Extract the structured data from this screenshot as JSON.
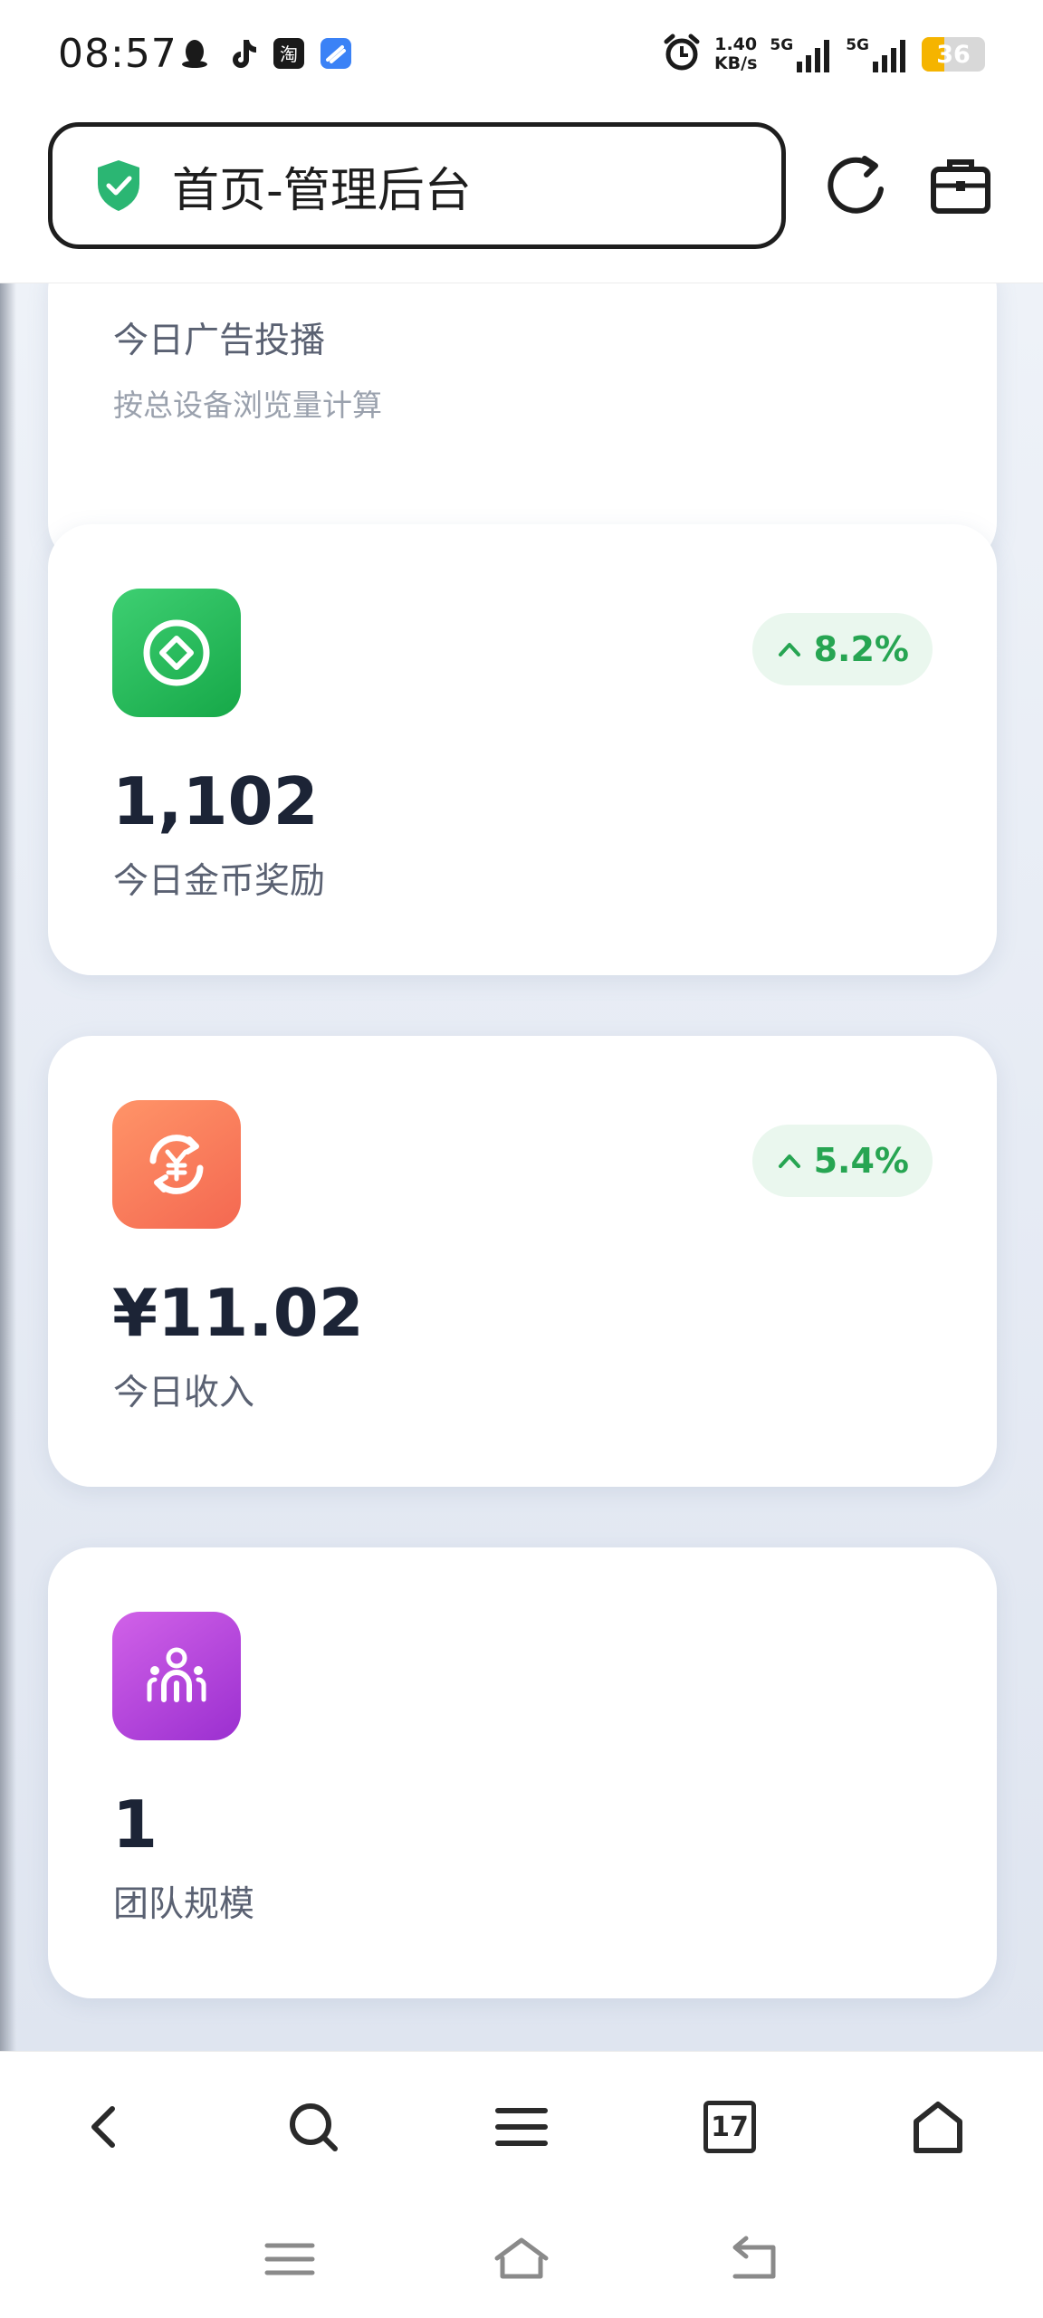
{
  "status_bar": {
    "time": "08:57",
    "net_speed_value": "1.40",
    "net_speed_unit": "KB/s",
    "signal_1": "5G",
    "signal_2": "5G",
    "battery": "36",
    "icons": [
      "qq-icon",
      "tiktok-icon",
      "taobao-icon",
      "app-icon",
      "alarm-icon"
    ]
  },
  "browser": {
    "title": "首页-管理后台"
  },
  "cards": {
    "partial": {
      "label": "今日广告投播",
      "sub": "按总设备浏览量计算"
    },
    "coins": {
      "value": "1,102",
      "label": "今日金币奖励",
      "trend": "8.2%",
      "icon": "coin-icon",
      "color": "#22b85a"
    },
    "income": {
      "value": "¥11.02",
      "label": "今日收入",
      "trend": "5.4%",
      "icon": "yuan-exchange-icon",
      "color": "#f77a5c"
    },
    "team": {
      "value": "1",
      "label": "团队规模",
      "icon": "team-icon",
      "color": "#b346df"
    }
  },
  "bottom_nav": {
    "tabs_count": "17",
    "items": [
      "back-icon",
      "search-icon",
      "menu-icon",
      "tabs-icon",
      "home-icon"
    ]
  }
}
